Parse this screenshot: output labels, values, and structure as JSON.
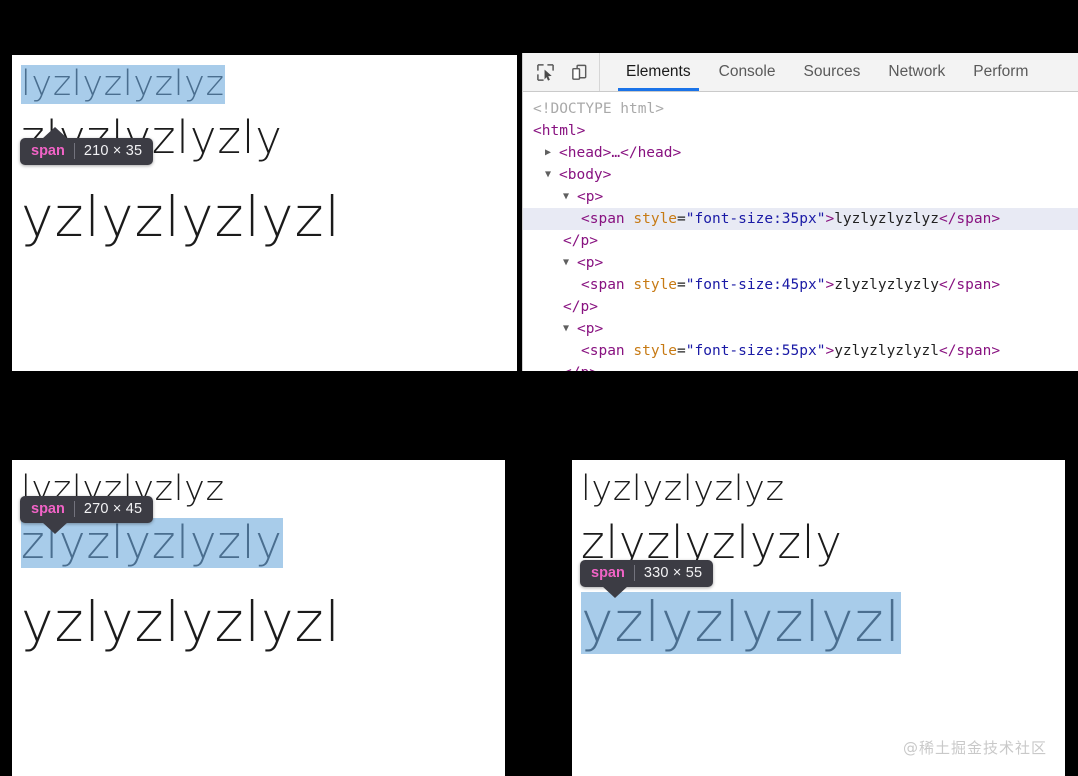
{
  "rendered_text": {
    "line1": "lyzlyzlyzlyz",
    "line2": "zlyzlyzlyzly",
    "line3": "yzlyzlyzlyzl"
  },
  "panels": {
    "top_left": {
      "name": "browser-render-35px-selected",
      "badge": {
        "tag": "span",
        "dims": "210 × 35"
      }
    },
    "bottom_left": {
      "name": "browser-render-45px-selected",
      "badge": {
        "tag": "span",
        "dims": "270 × 45"
      }
    },
    "bottom_right": {
      "name": "browser-render-55px-selected",
      "badge": {
        "tag": "span",
        "dims": "330 × 55"
      }
    }
  },
  "devtools": {
    "toolbar": {
      "inspect_icon": "inspect-element-icon",
      "device_icon": "device-toolbar-icon"
    },
    "tabs": [
      {
        "label": "Elements",
        "active": true
      },
      {
        "label": "Console",
        "active": false
      },
      {
        "label": "Sources",
        "active": false
      },
      {
        "label": "Network",
        "active": false
      },
      {
        "label": "Perform",
        "active": false
      }
    ],
    "tree": {
      "doctype": "<!DOCTYPE html>",
      "html_open": "<html>",
      "head_collapsed": "<head>…</head>",
      "body_open": "<body>",
      "p_open": "<p>",
      "p_close": "</p>",
      "spans": [
        {
          "tag_open": "<span ",
          "attr_name": "style",
          "attr_eq": "=",
          "attr_value": "\"font-size:35px\"",
          "gt": ">",
          "text": "lyzlyzlyzlyz",
          "tag_close": "</span>",
          "selected": true
        },
        {
          "tag_open": "<span ",
          "attr_name": "style",
          "attr_eq": "=",
          "attr_value": "\"font-size:45px\"",
          "gt": ">",
          "text": "zlyzlyzlyzly",
          "tag_close": "</span>",
          "selected": false
        },
        {
          "tag_open": "<span ",
          "attr_name": "style",
          "attr_eq": "=",
          "attr_value": "\"font-size:55px\"",
          "gt": ">",
          "text": "yzlyzlyzlyzl",
          "tag_close": "</span>",
          "selected": false
        }
      ],
      "triangle_collapsed": "▶",
      "triangle_expanded": "▼"
    }
  },
  "watermark": "@稀土掘金技术社区",
  "colors": {
    "highlight_blue": "#a8ccea",
    "highlight_text": "#4a6e8f",
    "badge_bg": "#3c3c44",
    "badge_tag": "#f163c6",
    "tab_active_underline": "#1a73e8",
    "tree_selected_row": "#e8eaf4",
    "tag_purple": "#881280",
    "attr_name_orange": "#c77a14",
    "attr_value_blue": "#1a1aa6"
  }
}
